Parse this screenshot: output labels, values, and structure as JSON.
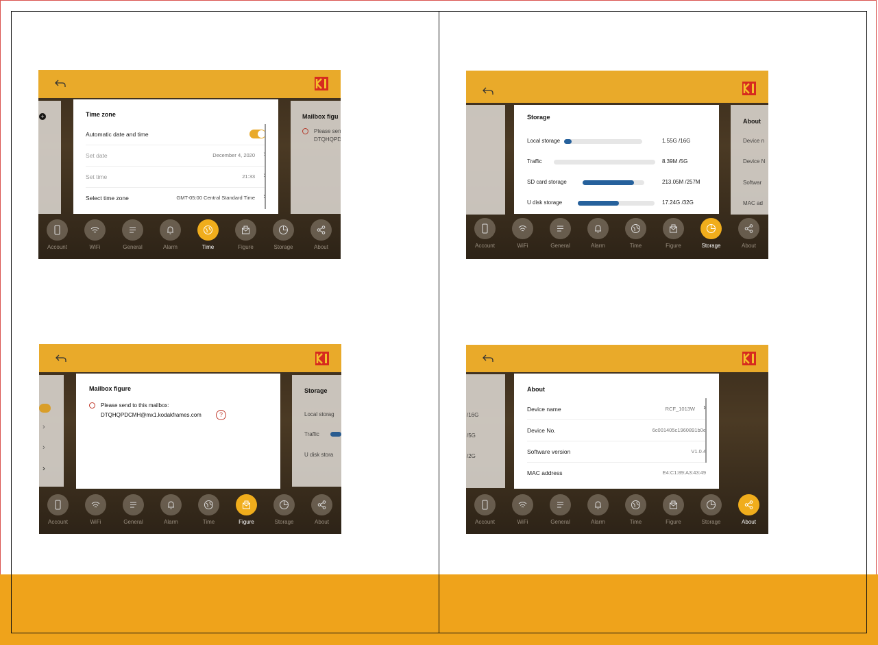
{
  "nav": [
    "Account",
    "WiFi",
    "General",
    "Alarm",
    "Time",
    "Figure",
    "Storage",
    "About"
  ],
  "colors": {
    "accent": "#e9aa2a",
    "bar": "#26619c",
    "band": "#efa31b"
  },
  "time_screen": {
    "title": "Time zone",
    "rows": [
      {
        "label": "Automatic date and time",
        "value": "",
        "toggle": true
      },
      {
        "label": "Set date",
        "value": "December 4, 2020"
      },
      {
        "label": "Set time",
        "value": "21:33"
      },
      {
        "label": "Select time zone",
        "value": "GMT-05:00 Central Standard Time"
      }
    ],
    "right_title": "Mailbox figu",
    "right_text1": "Please sen",
    "right_text2": "DTQHQPD"
  },
  "storage_screen": {
    "title": "Storage",
    "items": [
      {
        "label": "Local storage",
        "value": "1.55G /16G",
        "fill": 0.1
      },
      {
        "label": "Traffic",
        "value": "8.39M /5G",
        "fill": 0.0
      },
      {
        "label": "SD card storage",
        "value": "213.05M /257M",
        "fill": 0.83
      },
      {
        "label": "U disk storage",
        "value": "17.24G /32G",
        "fill": 0.54
      }
    ],
    "right_title": "About",
    "right_items": [
      "Device n",
      "Device N",
      "Softwar",
      "MAC ad"
    ]
  },
  "figure_screen": {
    "title": "Mailbox figure",
    "line1": "Please send to this mailbox:",
    "line2": "DTQHQPDCMH@mx1.kodakframes.com",
    "help": "?",
    "right_title": "Storage",
    "right_items": [
      "Local storag",
      "Traffic",
      "U disk stora"
    ]
  },
  "about_screen": {
    "title": "About",
    "rows": [
      {
        "label": "Device name",
        "value": "RCF_1013W"
      },
      {
        "label": "Device No.",
        "value": "6c001405c1960891b0e"
      },
      {
        "label": "Software version",
        "value": "V1.0.4"
      },
      {
        "label": "MAC address",
        "value": "E4:C1:89:A3:43:49"
      }
    ],
    "left_items": [
      "/16G",
      "/5G",
      "/2G"
    ]
  }
}
